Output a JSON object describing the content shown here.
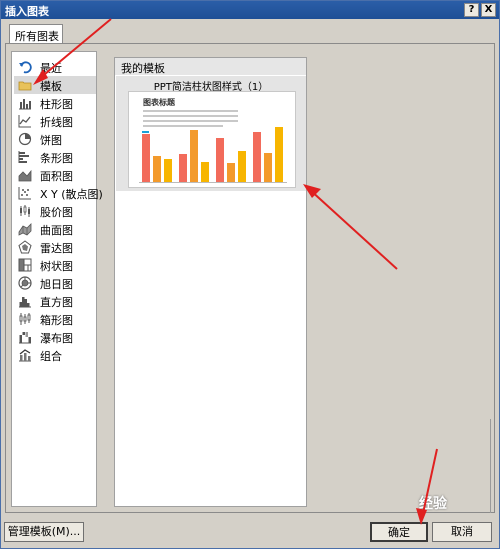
{
  "window": {
    "title": "插入图表",
    "help_label": "?",
    "close_label": "X"
  },
  "tab": {
    "label": "所有图表"
  },
  "categories": [
    {
      "label": "最近",
      "icon": "undo-icon"
    },
    {
      "label": "模板",
      "icon": "folder-icon"
    },
    {
      "label": "柱形图",
      "icon": "column-chart-icon"
    },
    {
      "label": "折线图",
      "icon": "line-chart-icon"
    },
    {
      "label": "饼图",
      "icon": "pie-chart-icon"
    },
    {
      "label": "条形图",
      "icon": "bar-chart-icon"
    },
    {
      "label": "面积图",
      "icon": "area-chart-icon"
    },
    {
      "label": "X Y (散点图)",
      "icon": "scatter-chart-icon"
    },
    {
      "label": "股价图",
      "icon": "stock-chart-icon"
    },
    {
      "label": "曲面图",
      "icon": "surface-chart-icon"
    },
    {
      "label": "雷达图",
      "icon": "radar-chart-icon"
    },
    {
      "label": "树状图",
      "icon": "treemap-chart-icon"
    },
    {
      "label": "旭日图",
      "icon": "sunburst-chart-icon"
    },
    {
      "label": "直方图",
      "icon": "histogram-chart-icon"
    },
    {
      "label": "箱形图",
      "icon": "box-chart-icon"
    },
    {
      "label": "瀑布图",
      "icon": "waterfall-chart-icon"
    },
    {
      "label": "组合",
      "icon": "combo-chart-icon"
    }
  ],
  "content": {
    "section_title": "我的模板",
    "template_name": "PPT简洁柱状图样式（1）",
    "thumb_title": "图表标题"
  },
  "buttons": {
    "manage": "管理模板(M)...",
    "ok": "确定",
    "cancel": "取消"
  },
  "watermark": "经验",
  "colors": {
    "bar_red": "#f26b5b",
    "bar_orange": "#f39a2c",
    "bar_yellow": "#f7b500",
    "annotation_arrow": "#e02020"
  }
}
